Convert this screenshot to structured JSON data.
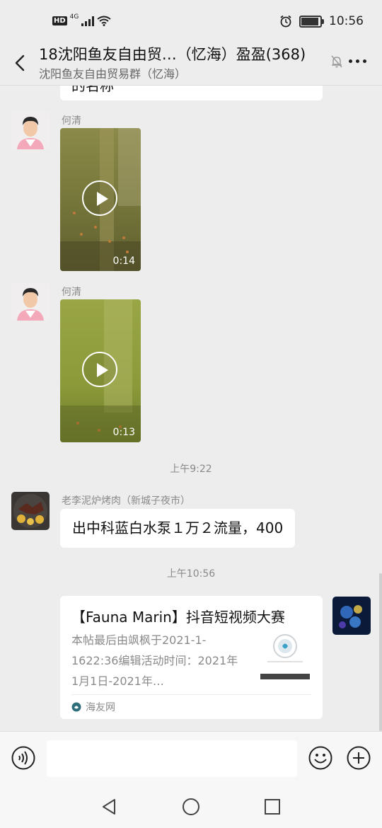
{
  "status_bar": {
    "left_badge": "HD",
    "network": "4G",
    "time": "10:56",
    "battery_level": 0.85
  },
  "header": {
    "title": "18沈阳鱼友自由贸…（忆海）盈盈(368)",
    "subtitle": "沈阳鱼友自由贸易群（忆海）"
  },
  "messages": {
    "previous_bubble_fragment": "的名称",
    "video1": {
      "sender": "何清",
      "duration": "0:14"
    },
    "video2": {
      "sender": "何清",
      "duration": "0:13"
    },
    "time1": "上午9:22",
    "text_msg": {
      "sender": "老李泥炉烤肉（新城子夜市）",
      "text": "出中科蓝白水泵１万２流量，400"
    },
    "time2": "上午10:56",
    "link_card": {
      "title": "【Fauna Marin】抖音短视频大赛",
      "description": "本帖最后由飒枫于2021-1-1622:36编辑活动时间：2021年1月1日-2021年…",
      "source": "海友网"
    }
  },
  "input": {
    "placeholder": ""
  },
  "colors": {
    "background": "#ededed",
    "bubble": "#ffffff",
    "secondary_text": "#8a8a8a"
  }
}
